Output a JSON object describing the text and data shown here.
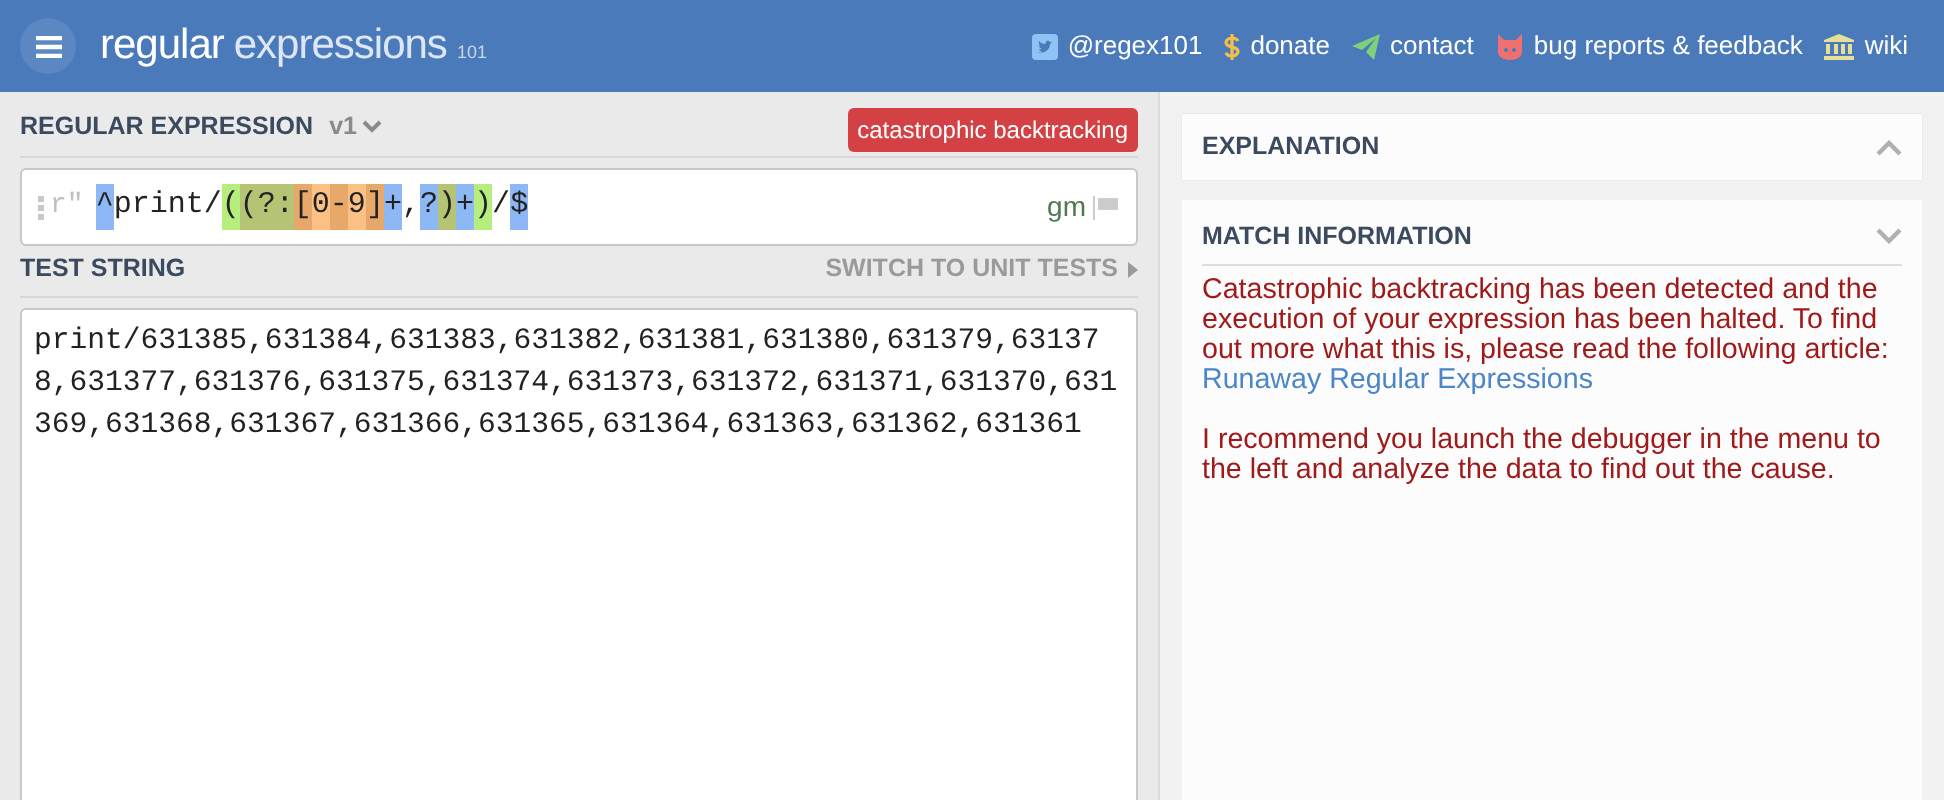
{
  "header": {
    "logo_main": "regular",
    "logo_sub": "expressions",
    "logo_version": "101",
    "links": [
      {
        "kind": "twitter",
        "label": "@regex101"
      },
      {
        "kind": "donate",
        "label": "donate"
      },
      {
        "kind": "contact",
        "label": "contact"
      },
      {
        "kind": "bug",
        "label": "bug reports & feedback"
      },
      {
        "kind": "wiki",
        "label": "wiki"
      }
    ]
  },
  "regex": {
    "title": "REGULAR EXPRESSION",
    "version": "v1",
    "error_badge": "catastrophic backtracking",
    "delimiter": "r\"",
    "flags": "gm",
    "tokens": [
      {
        "text": "^",
        "color": "#8db8f5"
      },
      {
        "text": "print/"
      },
      {
        "text": "(",
        "color": "#b5ee7e"
      },
      {
        "text": "(?:",
        "color": "#b4c474"
      },
      {
        "text": "[",
        "color": "#e8a86a"
      },
      {
        "text": "0",
        "color": "#fbc184"
      },
      {
        "text": "-",
        "color": "#e8a86a"
      },
      {
        "text": "9",
        "color": "#fbc184"
      },
      {
        "text": "]",
        "color": "#e8a86a"
      },
      {
        "text": "+",
        "color": "#8db8f5"
      },
      {
        "text": ","
      },
      {
        "text": "?",
        "color": "#8db8f5"
      },
      {
        "text": ")",
        "color": "#b4c474"
      },
      {
        "text": "+",
        "color": "#8db8f5"
      },
      {
        "text": ")",
        "color": "#b5ee7e"
      },
      {
        "text": "/"
      },
      {
        "text": "$",
        "color": "#8db8f5"
      }
    ]
  },
  "test_string": {
    "title": "TEST STRING",
    "switch_label": "SWITCH TO UNIT TESTS",
    "value": "print/631385,631384,631383,631382,631381,631380,631379,631378,631377,631376,631375,631374,631373,631372,631371,631370,631369,631368,631367,631366,631365,631364,631363,631362,631361"
  },
  "explanation": {
    "title": "EXPLANATION",
    "expanded": false
  },
  "match_information": {
    "title": "MATCH INFORMATION",
    "expanded": true,
    "message": "Catastrophic backtracking has been detected and the execution of your expression has been halted. To find out more what this is, please read the following article: ",
    "link": "Runaway Regular Expressions",
    "advice": "I recommend you launch the debugger in the menu to the left and analyze the data to find out the cause."
  }
}
